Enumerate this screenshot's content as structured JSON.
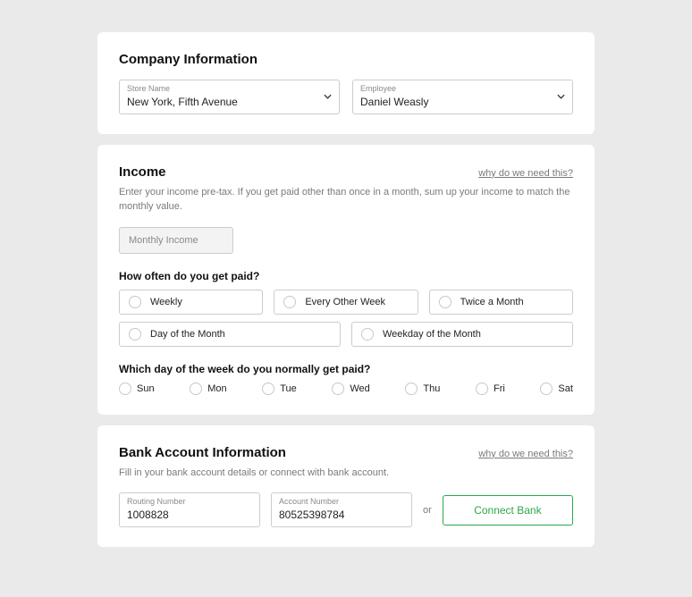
{
  "company": {
    "title": "Company Information",
    "store_label": "Store Name",
    "store_value": "New York, Fifth Avenue",
    "employee_label": "Employee",
    "employee_value": "Daniel Weasly"
  },
  "income": {
    "title": "Income",
    "help": "why do we need this?",
    "desc": "Enter your income pre-tax. If you get paid other than once in a month, sum up your income to match the monthly value.",
    "placeholder": "Monthly Income",
    "freq_question": "How often do you get paid?",
    "freq_options": {
      "weekly": "Weekly",
      "every_other": "Every Other Week",
      "twice": "Twice a Month",
      "day_of_month": "Day of the Month",
      "weekday_of_month": "Weekday of the Month"
    },
    "day_question": "Which day of the week do you normally get paid?",
    "days": {
      "sun": "Sun",
      "mon": "Mon",
      "tue": "Tue",
      "wed": "Wed",
      "thu": "Thu",
      "fri": "Fri",
      "sat": "Sat"
    }
  },
  "bank": {
    "title": "Bank Account Information",
    "help": "why do we need this?",
    "desc": "Fill in your bank account details or connect with bank account.",
    "routing_label": "Routing Number",
    "routing_value": "1008828",
    "account_label": "Account Number",
    "account_value": "80525398784",
    "or": "or",
    "connect": "Connect Bank"
  }
}
